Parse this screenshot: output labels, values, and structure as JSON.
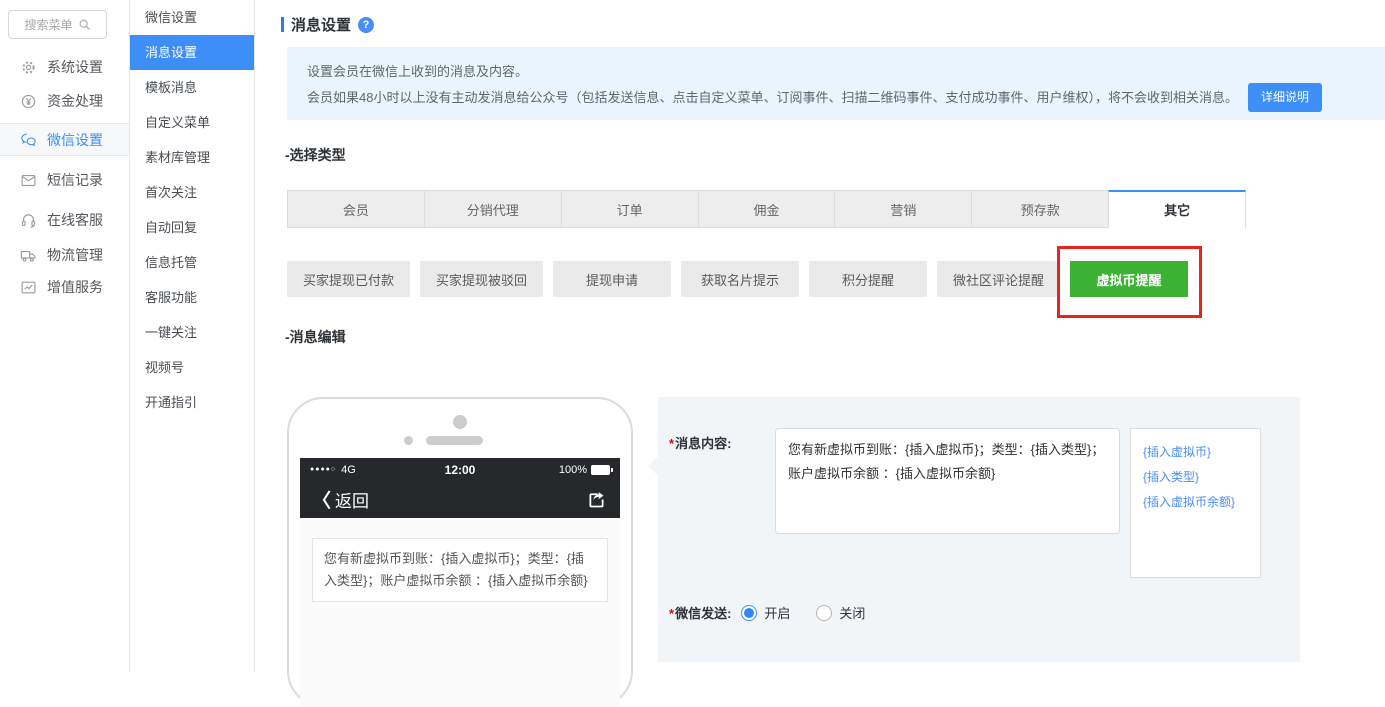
{
  "colors": {
    "accent": "#3e8ef7",
    "green": "#3cb234",
    "annotation_red": "#e8241f",
    "notice_bg": "#e9f4fd",
    "phone_bar": "#26282b"
  },
  "sidebar": {
    "search_placeholder": "搜索菜单",
    "items": [
      {
        "label": "系统设置",
        "icon": "gear-icon"
      },
      {
        "label": "资金处理",
        "icon": "yen-circle-icon"
      },
      {
        "label": "微信设置",
        "icon": "wechat-icon",
        "active": true
      },
      {
        "label": "短信记录",
        "icon": "envelope-icon"
      },
      {
        "label": "在线客服",
        "icon": "headset-icon"
      },
      {
        "label": "物流管理",
        "icon": "truck-icon"
      },
      {
        "label": "增值服务",
        "icon": "chart-icon"
      }
    ]
  },
  "submenu": {
    "items": [
      {
        "label": "微信设置"
      },
      {
        "label": "消息设置",
        "active": true
      },
      {
        "label": "模板消息"
      },
      {
        "label": "自定义菜单"
      },
      {
        "label": "素材库管理"
      },
      {
        "label": "首次关注"
      },
      {
        "label": "自动回复"
      },
      {
        "label": "信息托管"
      },
      {
        "label": "客服功能"
      },
      {
        "label": "一键关注"
      },
      {
        "label": "视频号"
      },
      {
        "label": "开通指引"
      }
    ]
  },
  "header": {
    "title": "消息设置",
    "help_icon": "question-circle-icon",
    "help_glyph": "?"
  },
  "notice": {
    "line1": "设置会员在微信上收到的消息及内容。",
    "line2": "会员如果48小时以上没有主动发消息给公众号（包括发送信息、点击自定义菜单、订阅事件、扫描二维码事件、支付成功事件、用户维权），将不会收到相关消息。",
    "button_label": "详细说明"
  },
  "types": {
    "section_label": "-选择类型",
    "tabs": [
      {
        "label": "会员"
      },
      {
        "label": "分销代理"
      },
      {
        "label": "订单"
      },
      {
        "label": "佣金"
      },
      {
        "label": "营销"
      },
      {
        "label": "预存款"
      },
      {
        "label": "其它",
        "active": true
      }
    ],
    "buttons": [
      {
        "label": "买家提现已付款"
      },
      {
        "label": "买家提现被驳回"
      },
      {
        "label": "提现申请"
      },
      {
        "label": "获取名片提示"
      },
      {
        "label": "积分提醒"
      },
      {
        "label": "微社区评论提醒"
      },
      {
        "label": "虚拟币提醒",
        "active": true,
        "annotated": true
      }
    ]
  },
  "edit": {
    "section_label": "-消息编辑",
    "required_mark": "*",
    "content_label": "消息内容:",
    "message_content": "您有新虚拟币到账：{插入虚拟币}；类型：{插入类型}；账户虚拟币余额 ：{插入虚拟币余额}",
    "insert_links": [
      "{插入虚拟币}",
      "{插入类型}",
      "{插入虚拟币余额}"
    ],
    "send_label": "微信发送:",
    "radio_on": "开启",
    "radio_off": "关闭",
    "radio_selected": "开启"
  },
  "phone": {
    "signal_dots": "●●●●○",
    "network": "4G",
    "time": "12:00",
    "battery": "100%",
    "back_chevron": "〈",
    "back_label": "返回"
  }
}
